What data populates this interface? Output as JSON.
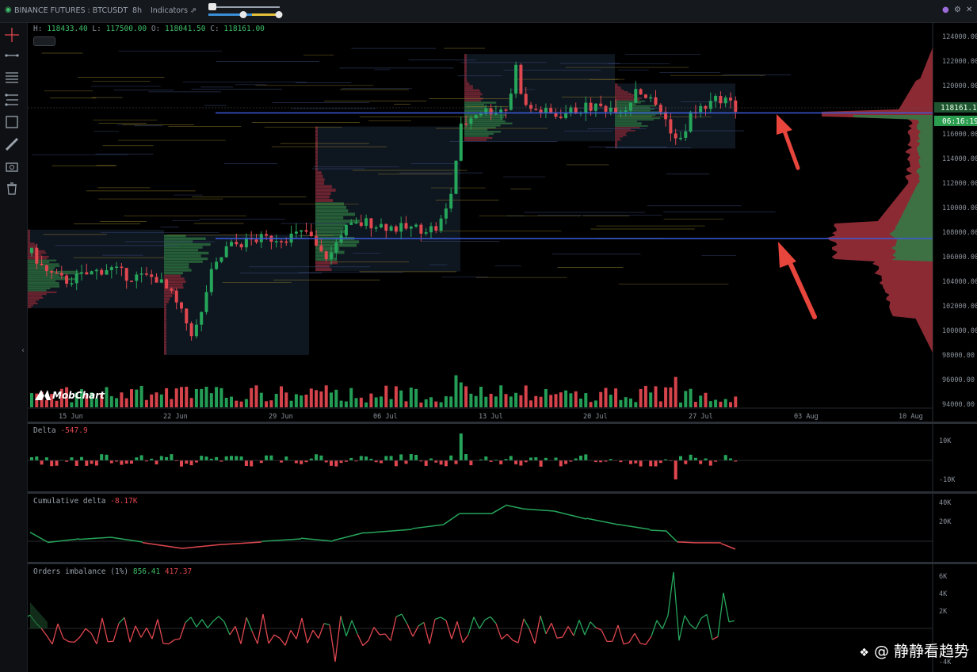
{
  "topbar": {
    "exchange_pair": "BINANCE FUTURES : BTCUSDT",
    "interval": "8h",
    "indicators_label": "Indicators"
  },
  "ohlc": {
    "h_label": "H:",
    "h": "118433.40",
    "l_label": "L:",
    "l": "117500.00",
    "o_label": "O:",
    "o": "118041.50",
    "c_label": "C:",
    "c": "118161.00"
  },
  "price_axis": [
    "124000.00",
    "122000.00",
    "120000.00",
    "118000.00",
    "116000.00",
    "114000.00",
    "112000.00",
    "110000.00",
    "108000.00",
    "106000.00",
    "104000.00",
    "102000.00",
    "100000.00",
    "98000.00",
    "96000.00",
    "94000.00"
  ],
  "current_price": "118161.10",
  "countdown": "06:16:19",
  "date_axis": [
    "15 Jun",
    "22 Jun",
    "29 Jun",
    "06 Jul",
    "13 Jul",
    "20 Jul",
    "27 Jul",
    "03 Aug",
    "10 Aug"
  ],
  "logo_text": "MobChart",
  "panels": {
    "delta": {
      "title": "Delta",
      "value": "-547.9",
      "ticks": [
        "10K",
        "-10K"
      ]
    },
    "cum_delta": {
      "title": "Cumulative delta",
      "value": "-8.17K",
      "ticks": [
        "40K",
        "20K"
      ]
    },
    "orders": {
      "title": "Orders imbalance (1%)",
      "value1": "856.41",
      "value2": "417.37",
      "ticks": [
        "6K",
        "4K",
        "2K",
        "-4K"
      ]
    }
  },
  "watermark": "@ 静静看趋势",
  "colors": {
    "up": "#26a65b",
    "down": "#e0474f",
    "level_line": "#3b5bdb",
    "arrow": "#e8453c",
    "accent": "#3fbf6a"
  }
}
